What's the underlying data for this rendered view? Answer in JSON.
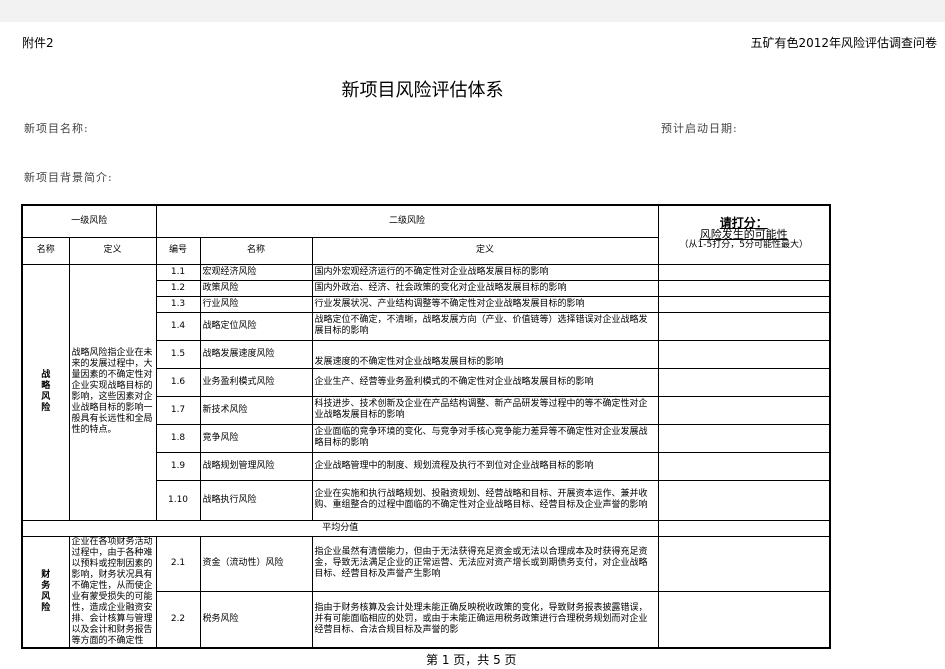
{
  "header": {
    "left": "附件2",
    "right": "五矿有色2012年风险评估调查问卷"
  },
  "title": "新项目风险评估体系",
  "fields": {
    "project_name": "新项目名称:",
    "start_date": "预计启动日期:",
    "background": "新项目背景简介:"
  },
  "table": {
    "level1": "一级风险",
    "level2": "二级风险",
    "score_title": "请打分：",
    "score_sub": "风险发生的可能性",
    "score_note": "（从1-5打分，5分可能性最大）",
    "col_name": "名称",
    "col_def": "定义",
    "col_no": "编号",
    "col_name2": "名称",
    "col_def2": "定义",
    "strategic": {
      "name": "战略风险",
      "definition": "战略风险指企业在未来的发展过程中，大量因素的不确定性对企业实现战略目标的影响，这些因素对企业战略目标的影响一般具有长远性和全局性的特点。",
      "rows": [
        {
          "no": "1.1",
          "name": "宏观经济风险",
          "def": "国内外宏观经济运行的不确定性对企业战略发展目标的影响"
        },
        {
          "no": "1.2",
          "name": "政策风险",
          "def": "国内外政治、经济、社会政策的变化对企业战略发展目标的影响"
        },
        {
          "no": "1.3",
          "name": "行业风险",
          "def": "行业发展状况、产业结构调整等不确定性对企业战略发展目标的影响"
        },
        {
          "no": "1.4",
          "name": "战略定位风险",
          "def": "战略定位不确定，不清晰，战略发展方向（产业、价值链等）选择错误对企业战略发展目标的影响"
        },
        {
          "no": "1.5",
          "name": "战略发展速度风险",
          "def": "发展速度的不确定性对企业战略发展目标的影响"
        },
        {
          "no": "1.6",
          "name": "业务盈利模式风险",
          "def": "企业生产、经营等业务盈利模式的不确定性对企业战略发展目标的影响"
        },
        {
          "no": "1.7",
          "name": "新技术风险",
          "def": "科技进步、技术创新及企业在产品结构调整、新产品研发等过程中的等不确定性对企业战略发展目标的影响"
        },
        {
          "no": "1.8",
          "name": "竞争风险",
          "def": "企业面临的竞争环境的变化、与竞争对手核心竞争能力差异等不确定性对企业发展战略目标的影响"
        },
        {
          "no": "1.9",
          "name": "战略规划管理风险",
          "def": "企业战略管理中的制度、规划流程及执行不到位对企业战略目标的影响"
        },
        {
          "no": "1.10",
          "name": "战略执行风险",
          "def": "企业在实施和执行战略规划、投融资规划、经营战略和目标、开展资本运作、兼并收购、重组整合的过程中面临的不确定性对企业战略目标、经营目标及企业声誉的影响"
        }
      ],
      "avg": "平均分值"
    },
    "finance": {
      "name": "财务风险",
      "definition": "企业在各项财务活动过程中，由于各种难以预料或控制因素的影响，财务状况具有不确定性，从而使企业有蒙受损失的可能性，造成企业融资安排、会计核算与管理以及会计和财务报告等方面的不确定性",
      "rows": [
        {
          "no": "2.1",
          "name": "资金（流动性）风险",
          "def": "指企业虽然有清偿能力，但由于无法获得充足资金或无法以合理成本及时获得充足资金，导致无法满足企业的正常运营、无法应对资产增长或到期债务支付，对企业战略目标、经营目标及声誉产生影响"
        },
        {
          "no": "2.2",
          "name": "税务风险",
          "def": "指由于财务核算及会计处理未能正确反映税收政策的变化，导致财务报表披露错误，并有可能面临相应的处罚，或由于未能正确运用税务政策进行合理税务规划而对企业经营目标、合法合规目标及声誉的影"
        }
      ]
    }
  },
  "footer": "第 1 页，共 5 页"
}
